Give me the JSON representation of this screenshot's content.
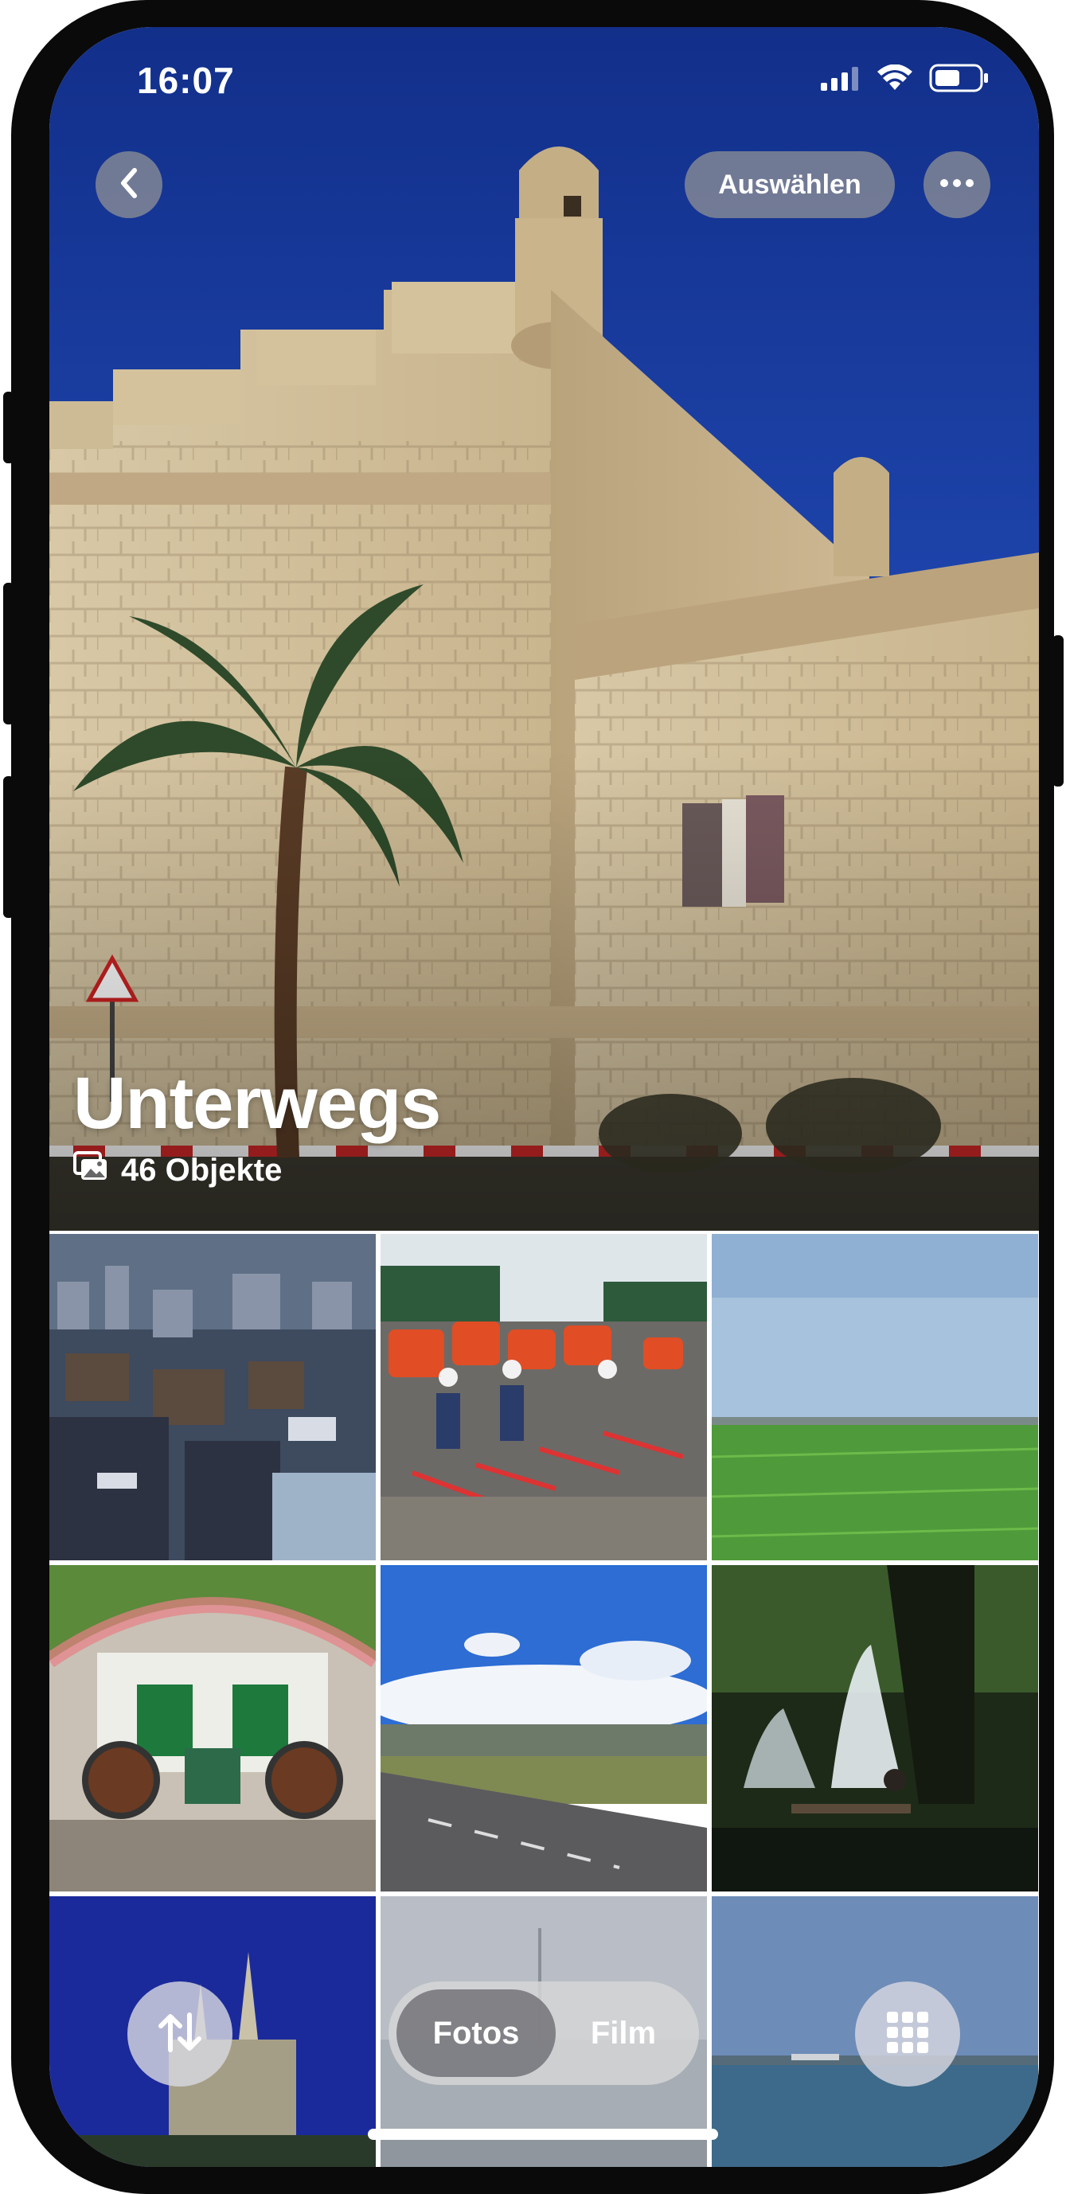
{
  "status_bar": {
    "time": "16:07"
  },
  "header": {
    "select_label": "Auswählen"
  },
  "album": {
    "title": "Unterwegs",
    "count": "46 Objekte"
  },
  "toolbar": {
    "segment_photos": "Fotos",
    "segment_film": "Film"
  },
  "icons": {
    "back": "chevron-left-icon",
    "more": "ellipsis-icon",
    "count": "photo-stack-icon",
    "sort": "sort-arrows-icon",
    "grid": "grid-dots-icon"
  },
  "colors": {
    "accent_white": "#ffffff",
    "button_gray": "#969696"
  }
}
